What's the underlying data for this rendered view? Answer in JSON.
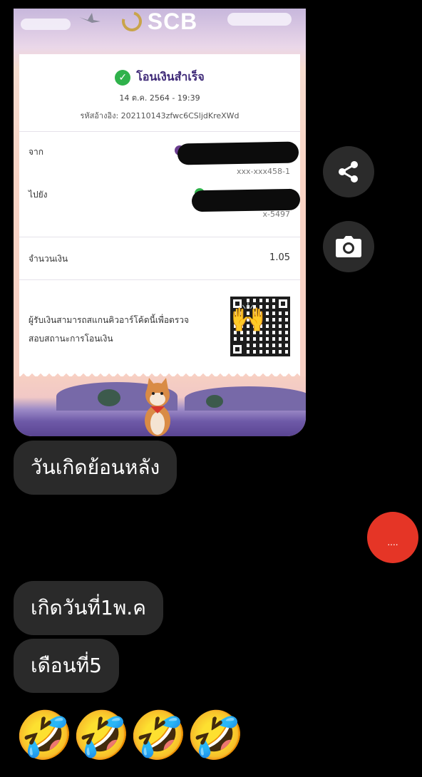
{
  "receipt": {
    "brand": "SCB",
    "status": "โอนเงินสำเร็จ",
    "datetime": "14 ต.ค. 2564 - 19:39",
    "reference": "รหัสอ้างอิง: 202110143zfwc6CSljdKreXWd",
    "from_label": "จาก",
    "from_account": "xxx-xxx458-1",
    "to_label": "ไปยัง",
    "to_account": "x-5497",
    "amount_label": "จำนวนเงิน",
    "amount_value": "1.05",
    "qr_note": "ผู้รับเงินสามารถสแกนคิวอาร์โค้ดนี้เพื่อตรวจสอบสถานะการโอนเงิน",
    "qr_overlay_emoji": "🙌"
  },
  "actions": {
    "share_icon": "share-icon",
    "camera_icon": "camera-icon"
  },
  "messages": [
    {
      "text": "วันเกิดย้อนหลัง"
    },
    {
      "text": "เกิดวันที่1พ.ค"
    },
    {
      "text": "เดือนที่5"
    }
  ],
  "typing_indicator": "....",
  "emoji_reactions": [
    "🤣",
    "🤣",
    "🤣",
    "🤣"
  ],
  "colors": {
    "background": "#000000",
    "bubble": "#2a2a2a",
    "typing_button": "#e53526",
    "success_green": "#2fb24b",
    "scb_purple": "#3f2a78"
  }
}
